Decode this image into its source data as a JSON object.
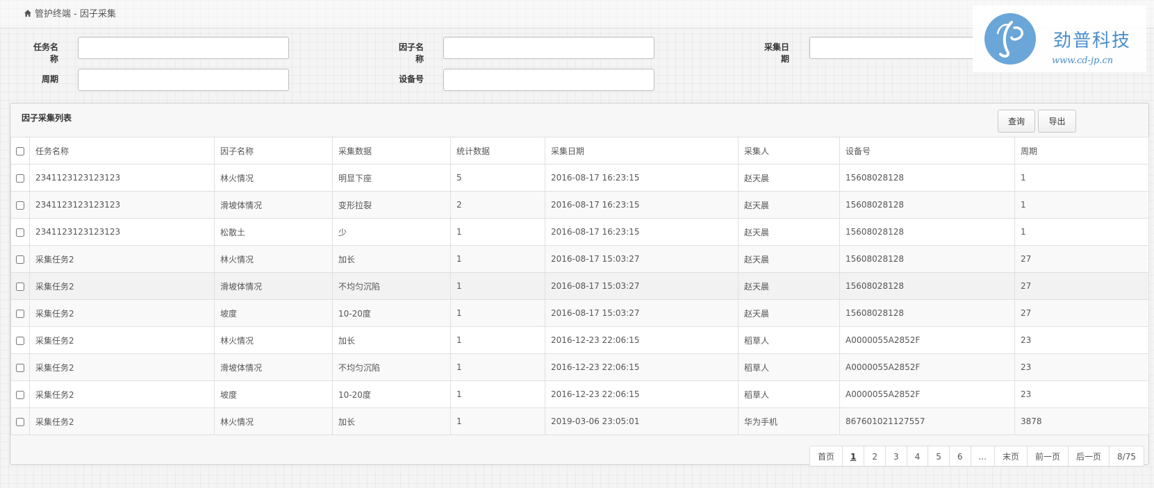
{
  "breadcrumb": {
    "icon": "home-icon",
    "text": "管护终端 - 因子采集"
  },
  "filters": {
    "task_name": {
      "label": "任务名称",
      "value": ""
    },
    "factor_name": {
      "label": "因子名称",
      "value": ""
    },
    "collect_date": {
      "label": "采集日期",
      "value": ""
    },
    "period": {
      "label": "周期",
      "value": ""
    },
    "device_no": {
      "label": "设备号",
      "value": ""
    }
  },
  "logo": {
    "name": "劲普科技",
    "url": "www.cd-jp.cn",
    "color": "#4a8ecb"
  },
  "panel": {
    "title": "因子采集列表",
    "query_label": "查询",
    "export_label": "导出"
  },
  "table": {
    "headers": [
      "任务名称",
      "因子名称",
      "采集数据",
      "统计数据",
      "采集日期",
      "采集人",
      "设备号",
      "周期"
    ],
    "rows": [
      [
        "2341123123123123",
        "林火情况",
        "明显下座",
        "5",
        "2016-08-17 16:23:15",
        "赵天晨",
        "15608028128",
        "1"
      ],
      [
        "2341123123123123",
        "滑坡体情况",
        "变形拉裂",
        "2",
        "2016-08-17 16:23:15",
        "赵天晨",
        "15608028128",
        "1"
      ],
      [
        "2341123123123123",
        "松散土",
        "少",
        "1",
        "2016-08-17 16:23:15",
        "赵天晨",
        "15608028128",
        "1"
      ],
      [
        "采集任务2",
        "林火情况",
        "加长",
        "1",
        "2016-08-17 15:03:27",
        "赵天晨",
        "15608028128",
        "27"
      ],
      [
        "采集任务2",
        "滑坡体情况",
        "不均匀沉陷",
        "1",
        "2016-08-17 15:03:27",
        "赵天晨",
        "15608028128",
        "27"
      ],
      [
        "采集任务2",
        "坡度",
        "10-20度",
        "1",
        "2016-08-17 15:03:27",
        "赵天晨",
        "15608028128",
        "27"
      ],
      [
        "采集任务2",
        "林火情况",
        "加长",
        "1",
        "2016-12-23 22:06:15",
        "稻草人",
        "A0000055A2852F",
        "23"
      ],
      [
        "采集任务2",
        "滑坡体情况",
        "不均匀沉陷",
        "1",
        "2016-12-23 22:06:15",
        "稻草人",
        "A0000055A2852F",
        "23"
      ],
      [
        "采集任务2",
        "坡度",
        "10-20度",
        "1",
        "2016-12-23 22:06:15",
        "稻草人",
        "A0000055A2852F",
        "23"
      ],
      [
        "采集任务2",
        "林火情况",
        "加长",
        "1",
        "2019-03-06 23:05:01",
        "华为手机",
        "867601021127557",
        "3878"
      ]
    ]
  },
  "pagination": {
    "first": "首页",
    "pages": [
      "1",
      "2",
      "3",
      "4",
      "5",
      "6"
    ],
    "ellipsis": "...",
    "last": "末页",
    "prev": "前一页",
    "next": "后一页",
    "info": "8/75"
  }
}
